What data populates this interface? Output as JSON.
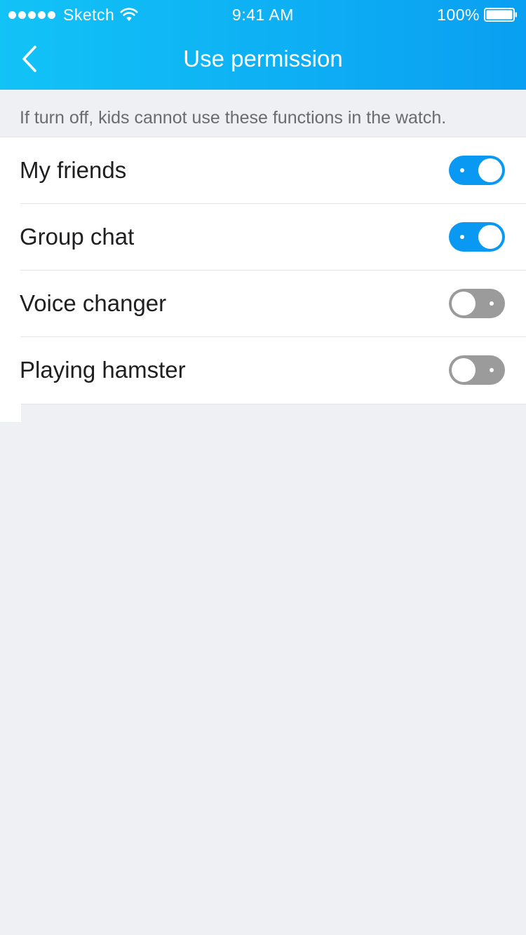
{
  "status_bar": {
    "carrier": "Sketch",
    "time": "9:41 AM",
    "battery": "100%",
    "signal_icon": "signal-dots-icon",
    "wifi_icon": "wifi-icon",
    "battery_icon": "battery-icon"
  },
  "nav": {
    "title": "Use permission",
    "back_icon": "chevron-left-icon"
  },
  "hint": "If turn off, kids cannot use these functions in the watch.",
  "permissions": [
    {
      "label": "My friends",
      "enabled": true
    },
    {
      "label": "Group chat",
      "enabled": true
    },
    {
      "label": "Voice changer",
      "enabled": false
    },
    {
      "label": "Playing hamster",
      "enabled": false
    }
  ],
  "colors": {
    "header_gradient_start": "#12c3f6",
    "header_gradient_end": "#0a9ff2",
    "toggle_on": "#0a99f2",
    "toggle_off": "#9b9b9b",
    "background": "#eff0f4"
  }
}
